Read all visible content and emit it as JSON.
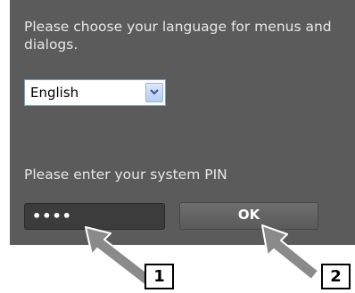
{
  "prompt_text": "Please choose your language for menus and dialogs.",
  "language_select": {
    "value": "English"
  },
  "pin_label": "Please enter your system PIN",
  "pin_input": {
    "value": "••••"
  },
  "ok_button": {
    "label": "OK"
  },
  "callouts": [
    "1",
    "2"
  ],
  "colors": {
    "panel": "#5b5b5b",
    "text": "#e8e8e8",
    "arrow": "#808080"
  }
}
